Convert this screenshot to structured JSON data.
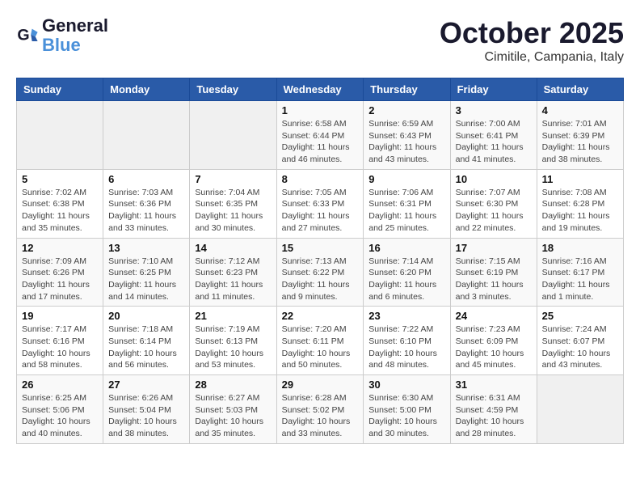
{
  "header": {
    "logo_general": "General",
    "logo_blue": "Blue",
    "month_title": "October 2025",
    "location": "Cimitile, Campania, Italy"
  },
  "weekdays": [
    "Sunday",
    "Monday",
    "Tuesday",
    "Wednesday",
    "Thursday",
    "Friday",
    "Saturday"
  ],
  "weeks": [
    [
      {
        "day": "",
        "detail": ""
      },
      {
        "day": "",
        "detail": ""
      },
      {
        "day": "",
        "detail": ""
      },
      {
        "day": "1",
        "detail": "Sunrise: 6:58 AM\nSunset: 6:44 PM\nDaylight: 11 hours\nand 46 minutes."
      },
      {
        "day": "2",
        "detail": "Sunrise: 6:59 AM\nSunset: 6:43 PM\nDaylight: 11 hours\nand 43 minutes."
      },
      {
        "day": "3",
        "detail": "Sunrise: 7:00 AM\nSunset: 6:41 PM\nDaylight: 11 hours\nand 41 minutes."
      },
      {
        "day": "4",
        "detail": "Sunrise: 7:01 AM\nSunset: 6:39 PM\nDaylight: 11 hours\nand 38 minutes."
      }
    ],
    [
      {
        "day": "5",
        "detail": "Sunrise: 7:02 AM\nSunset: 6:38 PM\nDaylight: 11 hours\nand 35 minutes."
      },
      {
        "day": "6",
        "detail": "Sunrise: 7:03 AM\nSunset: 6:36 PM\nDaylight: 11 hours\nand 33 minutes."
      },
      {
        "day": "7",
        "detail": "Sunrise: 7:04 AM\nSunset: 6:35 PM\nDaylight: 11 hours\nand 30 minutes."
      },
      {
        "day": "8",
        "detail": "Sunrise: 7:05 AM\nSunset: 6:33 PM\nDaylight: 11 hours\nand 27 minutes."
      },
      {
        "day": "9",
        "detail": "Sunrise: 7:06 AM\nSunset: 6:31 PM\nDaylight: 11 hours\nand 25 minutes."
      },
      {
        "day": "10",
        "detail": "Sunrise: 7:07 AM\nSunset: 6:30 PM\nDaylight: 11 hours\nand 22 minutes."
      },
      {
        "day": "11",
        "detail": "Sunrise: 7:08 AM\nSunset: 6:28 PM\nDaylight: 11 hours\nand 19 minutes."
      }
    ],
    [
      {
        "day": "12",
        "detail": "Sunrise: 7:09 AM\nSunset: 6:26 PM\nDaylight: 11 hours\nand 17 minutes."
      },
      {
        "day": "13",
        "detail": "Sunrise: 7:10 AM\nSunset: 6:25 PM\nDaylight: 11 hours\nand 14 minutes."
      },
      {
        "day": "14",
        "detail": "Sunrise: 7:12 AM\nSunset: 6:23 PM\nDaylight: 11 hours\nand 11 minutes."
      },
      {
        "day": "15",
        "detail": "Sunrise: 7:13 AM\nSunset: 6:22 PM\nDaylight: 11 hours\nand 9 minutes."
      },
      {
        "day": "16",
        "detail": "Sunrise: 7:14 AM\nSunset: 6:20 PM\nDaylight: 11 hours\nand 6 minutes."
      },
      {
        "day": "17",
        "detail": "Sunrise: 7:15 AM\nSunset: 6:19 PM\nDaylight: 11 hours\nand 3 minutes."
      },
      {
        "day": "18",
        "detail": "Sunrise: 7:16 AM\nSunset: 6:17 PM\nDaylight: 11 hours\nand 1 minute."
      }
    ],
    [
      {
        "day": "19",
        "detail": "Sunrise: 7:17 AM\nSunset: 6:16 PM\nDaylight: 10 hours\nand 58 minutes."
      },
      {
        "day": "20",
        "detail": "Sunrise: 7:18 AM\nSunset: 6:14 PM\nDaylight: 10 hours\nand 56 minutes."
      },
      {
        "day": "21",
        "detail": "Sunrise: 7:19 AM\nSunset: 6:13 PM\nDaylight: 10 hours\nand 53 minutes."
      },
      {
        "day": "22",
        "detail": "Sunrise: 7:20 AM\nSunset: 6:11 PM\nDaylight: 10 hours\nand 50 minutes."
      },
      {
        "day": "23",
        "detail": "Sunrise: 7:22 AM\nSunset: 6:10 PM\nDaylight: 10 hours\nand 48 minutes."
      },
      {
        "day": "24",
        "detail": "Sunrise: 7:23 AM\nSunset: 6:09 PM\nDaylight: 10 hours\nand 45 minutes."
      },
      {
        "day": "25",
        "detail": "Sunrise: 7:24 AM\nSunset: 6:07 PM\nDaylight: 10 hours\nand 43 minutes."
      }
    ],
    [
      {
        "day": "26",
        "detail": "Sunrise: 6:25 AM\nSunset: 5:06 PM\nDaylight: 10 hours\nand 40 minutes."
      },
      {
        "day": "27",
        "detail": "Sunrise: 6:26 AM\nSunset: 5:04 PM\nDaylight: 10 hours\nand 38 minutes."
      },
      {
        "day": "28",
        "detail": "Sunrise: 6:27 AM\nSunset: 5:03 PM\nDaylight: 10 hours\nand 35 minutes."
      },
      {
        "day": "29",
        "detail": "Sunrise: 6:28 AM\nSunset: 5:02 PM\nDaylight: 10 hours\nand 33 minutes."
      },
      {
        "day": "30",
        "detail": "Sunrise: 6:30 AM\nSunset: 5:00 PM\nDaylight: 10 hours\nand 30 minutes."
      },
      {
        "day": "31",
        "detail": "Sunrise: 6:31 AM\nSunset: 4:59 PM\nDaylight: 10 hours\nand 28 minutes."
      },
      {
        "day": "",
        "detail": ""
      }
    ]
  ]
}
